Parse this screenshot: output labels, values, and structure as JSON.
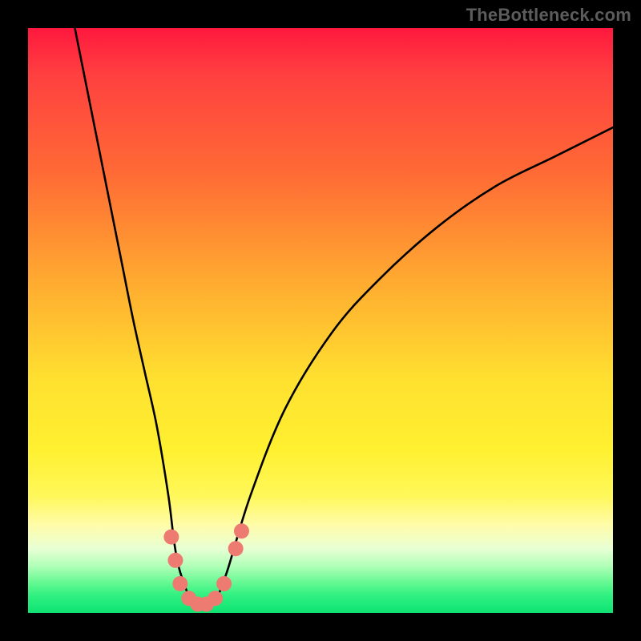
{
  "watermark": "TheBottleneck.com",
  "chart_data": {
    "type": "line",
    "title": "",
    "xlabel": "",
    "ylabel": "",
    "xlim": [
      0,
      100
    ],
    "ylim": [
      0,
      100
    ],
    "series": [
      {
        "name": "curve",
        "x": [
          8,
          10,
          12,
          14,
          16,
          18,
          20,
          22,
          24,
          25,
          26,
          28,
          30,
          31,
          32,
          34,
          38,
          44,
          52,
          60,
          70,
          80,
          90,
          100
        ],
        "y": [
          100,
          90,
          80,
          70,
          60,
          50,
          41,
          32,
          20,
          12,
          7,
          2,
          1,
          1,
          2,
          7,
          20,
          35,
          48,
          57,
          66,
          73,
          78,
          83
        ]
      }
    ],
    "markers": [
      {
        "x": 24.5,
        "y": 13
      },
      {
        "x": 25.2,
        "y": 9
      },
      {
        "x": 26.0,
        "y": 5
      },
      {
        "x": 27.5,
        "y": 2.5
      },
      {
        "x": 29.0,
        "y": 1.5
      },
      {
        "x": 30.5,
        "y": 1.5
      },
      {
        "x": 32.0,
        "y": 2.5
      },
      {
        "x": 33.5,
        "y": 5
      },
      {
        "x": 35.5,
        "y": 11
      },
      {
        "x": 36.5,
        "y": 14
      }
    ],
    "background_gradient": {
      "top": "#ff183e",
      "mid": "#ffe030",
      "bottom": "#10e070"
    },
    "curve_color": "#000000",
    "marker_color": "#ed7b72"
  }
}
